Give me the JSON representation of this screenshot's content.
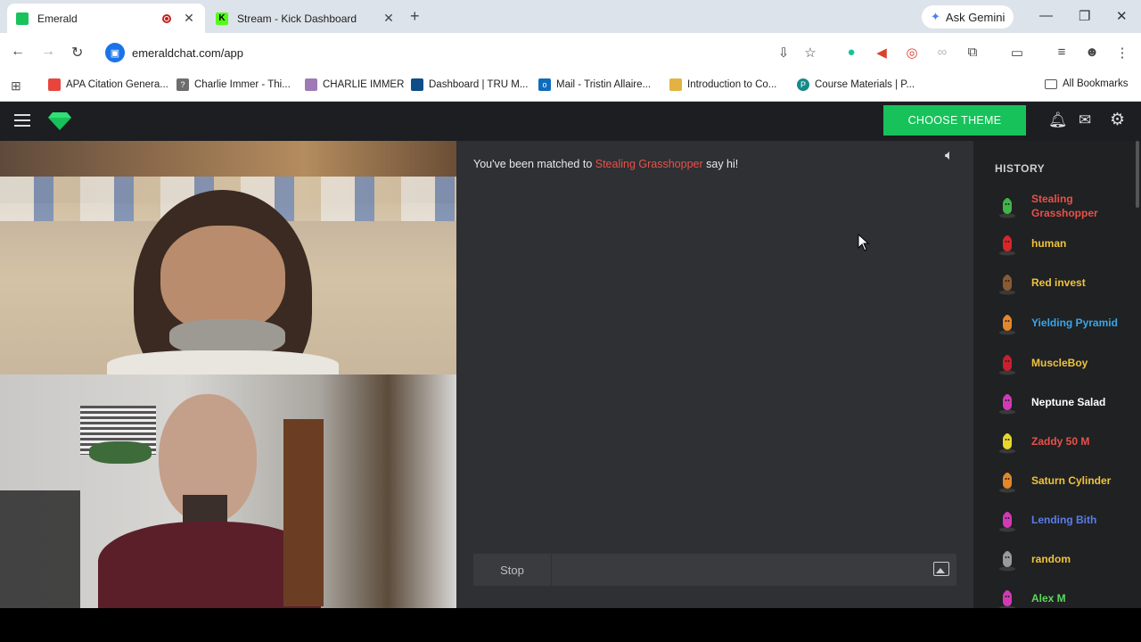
{
  "tabs": [
    {
      "title": "Emerald",
      "active": true,
      "favicon_color": "#19c35b"
    },
    {
      "title": "Stream - Kick Dashboard",
      "active": false,
      "favicon_color": "#53fc18"
    }
  ],
  "gemini_label": "Ask Gemini",
  "url": "emeraldchat.com/app",
  "bookmarks": [
    {
      "label": "APA Citation Genera...",
      "icon": "apa-icon",
      "color": "#e8453c"
    },
    {
      "label": "Charlie Immer - Thi...",
      "icon": "charlie-icon",
      "color": "#6d6d6d"
    },
    {
      "label": "CHARLIE IMMER",
      "icon": "puzzle-icon",
      "color": "#9e7bb5"
    },
    {
      "label": "Dashboard | TRU M...",
      "icon": "tru-icon",
      "color": "#0d4d8a"
    },
    {
      "label": "Mail - Tristin Allaire...",
      "icon": "outlook-icon",
      "color": "#0f6cbd"
    },
    {
      "label": "Introduction to Co...",
      "icon": "sun-icon",
      "color": "#e3b341"
    },
    {
      "label": "Course Materials | P...",
      "icon": "course-icon",
      "color": "#148a8a"
    }
  ],
  "all_bookmarks": "All Bookmarks",
  "app": {
    "theme_button": "CHOOSE THEME",
    "brand_color": "#18c25a"
  },
  "chat": {
    "matched_prefix": "You've been matched to ",
    "matched_name": "Stealing Grasshopper",
    "matched_suffix": " say hi!",
    "stop_label": "Stop",
    "input_value": ""
  },
  "history": {
    "title": "HISTORY",
    "items": [
      {
        "name": "Stealing Grasshopper",
        "color": "#e8514a",
        "avatar_color": "#3fb54a"
      },
      {
        "name": "human",
        "color": "#f0c33c",
        "avatar_color": "#d8262b"
      },
      {
        "name": "Red invest",
        "color": "#f0c33c",
        "avatar_color": "#8a5a32"
      },
      {
        "name": "Yielding Pyramid",
        "color": "#3aa6e8",
        "avatar_color": "#e3872a"
      },
      {
        "name": "MuscleBoy",
        "color": "#f0c33c",
        "avatar_color": "#c91f2e"
      },
      {
        "name": "Neptune Salad",
        "color": "#ffffff",
        "avatar_color": "#d23ab5"
      },
      {
        "name": "Zaddy 50 M",
        "color": "#e8514a",
        "avatar_color": "#e6d82c"
      },
      {
        "name": "Saturn Cylinder",
        "color": "#f0c33c",
        "avatar_color": "#e3872a"
      },
      {
        "name": "Lending Bith",
        "color": "#5b7de8",
        "avatar_color": "#d23ab5"
      },
      {
        "name": "random",
        "color": "#f0c33c",
        "avatar_color": "#9a9a9a"
      },
      {
        "name": "Alex M",
        "color": "#5bd85b",
        "avatar_color": "#d23ab5"
      }
    ]
  }
}
